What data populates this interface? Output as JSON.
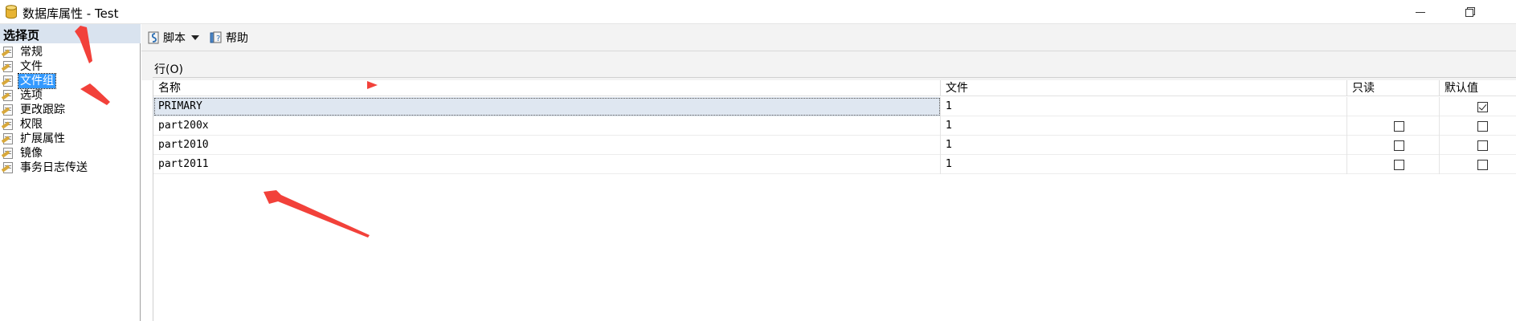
{
  "window": {
    "title": "数据库属性 - Test"
  },
  "left_pane": {
    "header": "选择页",
    "items": [
      {
        "label": "常规",
        "icon": "page-wrench-icon",
        "selected": false
      },
      {
        "label": "文件",
        "icon": "page-wrench-icon",
        "selected": false
      },
      {
        "label": "文件组",
        "icon": "page-wrench-icon",
        "selected": true
      },
      {
        "label": "选项",
        "icon": "page-wrench-icon",
        "selected": false
      },
      {
        "label": "更改跟踪",
        "icon": "page-wrench-icon",
        "selected": false
      },
      {
        "label": "权限",
        "icon": "page-wrench-icon",
        "selected": false
      },
      {
        "label": "扩展属性",
        "icon": "page-wrench-icon",
        "selected": false
      },
      {
        "label": "镜像",
        "icon": "page-wrench-icon",
        "selected": false
      },
      {
        "label": "事务日志传送",
        "icon": "page-wrench-icon",
        "selected": false
      }
    ]
  },
  "toolbar": {
    "script_label": "脚本",
    "help_label": "帮助"
  },
  "section": {
    "label": "行(O)"
  },
  "grid": {
    "columns": [
      "名称",
      "文件",
      "只读",
      "默认值"
    ],
    "rows": [
      {
        "name": "PRIMARY",
        "files": "1",
        "read_only": null,
        "default": true,
        "selected": true
      },
      {
        "name": "part200x",
        "files": "1",
        "read_only": false,
        "default": false,
        "selected": false
      },
      {
        "name": "part2010",
        "files": "1",
        "read_only": false,
        "default": false,
        "selected": false
      },
      {
        "name": "part2011",
        "files": "1",
        "read_only": false,
        "default": false,
        "selected": false
      }
    ]
  },
  "colors": {
    "selection_blue": "#3399ff",
    "header_band": "#d9e3ef",
    "annotation_red": "#f2413a"
  }
}
